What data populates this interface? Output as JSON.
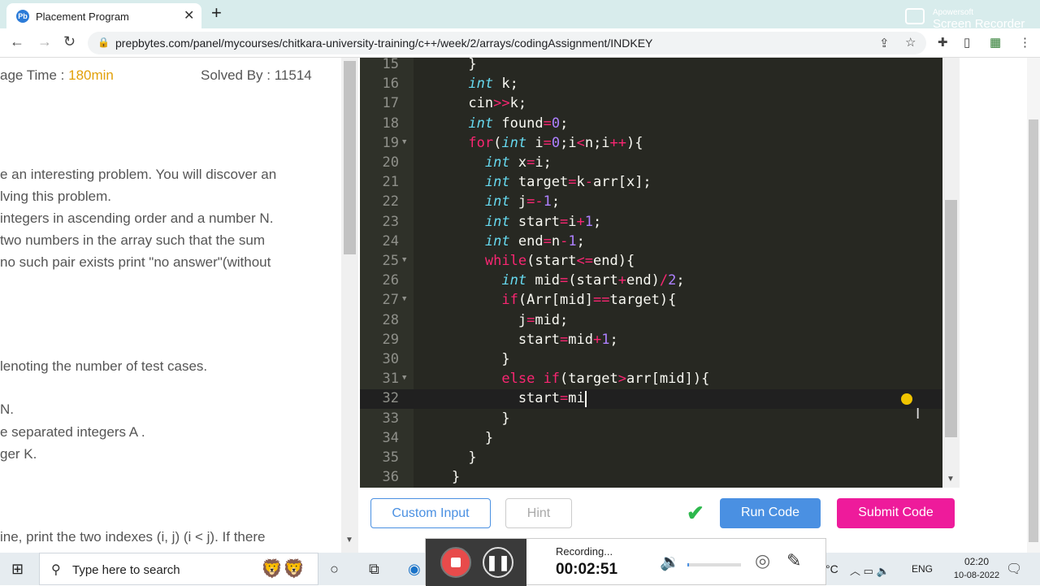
{
  "browser": {
    "tab_title": "Placement Program",
    "tab_icon_text": "Pb",
    "url": "prepbytes.com/panel/mycourses/chitkara-university-training/c++/week/2/arrays/codingAssignment/INDKEY",
    "recorder_watermark_brand": "Apowersoft",
    "recorder_watermark_name": "Screen Recorder"
  },
  "problem": {
    "avg_time_label": "age Time : ",
    "avg_time_value": "180min",
    "solved_by": "Solved By : 11514",
    "lines": [
      "e an interesting problem. You will discover an",
      "lving this problem.",
      "integers in ascending order and a number N.",
      "two numbers in the array such that the sum",
      " no such pair exists print \"no answer\"(without",
      "lenoting the number of test cases.",
      "N.",
      "e separated integers A .",
      "ger K.",
      "ine, print the two indexes (i, j) (i < j). If there"
    ]
  },
  "code": {
    "lines": [
      {
        "n": "15",
        "fold": false,
        "t": "      }"
      },
      {
        "n": "16",
        "fold": false,
        "t": "      int k;"
      },
      {
        "n": "17",
        "fold": false,
        "t": "      cin>>k;"
      },
      {
        "n": "18",
        "fold": false,
        "t": "      int found=0;"
      },
      {
        "n": "19",
        "fold": true,
        "t": "      for(int i=0;i<n;i++){"
      },
      {
        "n": "20",
        "fold": false,
        "t": "        int x=i;"
      },
      {
        "n": "21",
        "fold": false,
        "t": "        int target=k-arr[x];"
      },
      {
        "n": "22",
        "fold": false,
        "t": "        int j=-1;"
      },
      {
        "n": "23",
        "fold": false,
        "t": "        int start=i+1;"
      },
      {
        "n": "24",
        "fold": false,
        "t": "        int end=n-1;"
      },
      {
        "n": "25",
        "fold": true,
        "t": "        while(start<=end){"
      },
      {
        "n": "26",
        "fold": false,
        "t": "          int mid=(start+end)/2;"
      },
      {
        "n": "27",
        "fold": true,
        "t": "          if(Arr[mid]==target){"
      },
      {
        "n": "28",
        "fold": false,
        "t": "            j=mid;"
      },
      {
        "n": "29",
        "fold": false,
        "t": "            start=mid+1;"
      },
      {
        "n": "30",
        "fold": false,
        "t": "          }"
      },
      {
        "n": "31",
        "fold": true,
        "t": "          else if(target>arr[mid]){"
      },
      {
        "n": "32",
        "fold": false,
        "t": "            start=mi"
      },
      {
        "n": "33",
        "fold": false,
        "t": "          }"
      },
      {
        "n": "34",
        "fold": false,
        "t": "        }"
      },
      {
        "n": "35",
        "fold": false,
        "t": "      }"
      },
      {
        "n": "36",
        "fold": false,
        "t": "    }"
      }
    ],
    "active_line": "32"
  },
  "actions": {
    "custom_input": "Custom Input",
    "hint": "Hint",
    "run_code": "Run Code",
    "submit_code": "Submit Code"
  },
  "recorder": {
    "status": "Recording...",
    "time": "00:02:51",
    "volume_level": 0.03
  },
  "taskbar": {
    "search_placeholder": "Type here to search",
    "temp_unit": "°C",
    "language": "ENG",
    "time": "02:20",
    "date": "10-08-2022"
  },
  "colors": {
    "accent": "#4a90e2",
    "submit": "#ee1b9b",
    "time_highlight": "#e2a10a",
    "editor_bg": "#272822"
  }
}
